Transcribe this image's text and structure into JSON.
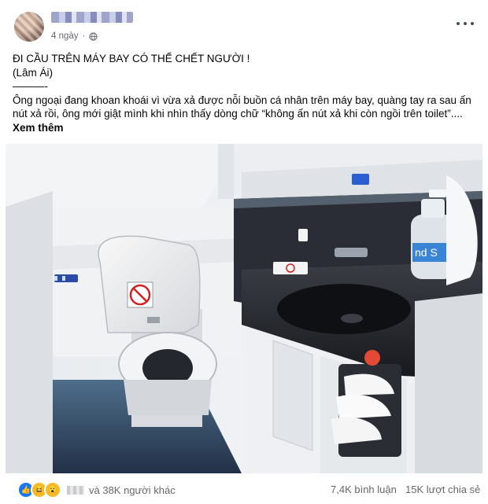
{
  "post": {
    "timestamp": "4 ngày",
    "privacy_icon": "globe-icon",
    "more_icon": "more-options-icon",
    "text_lines": [
      "ĐI CẦU TRÊN MÁY BAY CÓ THỂ CHẾT NGƯỜI !",
      "(Lâm Ái)",
      "———-",
      "Ông ngoại đang khoan khoái vì vừa xả được nỗi buồn cá nhân trên máy bay, quàng tay ra sau ấn",
      "nút xả rồi, ông mới giật mình khi nhìn thấy dòng chữ “không ấn nút xả khi còn ngồi trên toilet”...."
    ],
    "see_more": "Xem thêm"
  },
  "footer": {
    "reaction_icons": [
      "like-icon",
      "haha-icon",
      "wow-icon"
    ],
    "reaction_text": "và 38K người khác",
    "comments": "7,4K bình luận",
    "shares": "15K lượt chia sẻ"
  },
  "photo": {
    "sign_text": "nd S",
    "colors": {
      "accent": "#1877f2",
      "sink": "#202228",
      "wall": "#eef0f2"
    }
  }
}
